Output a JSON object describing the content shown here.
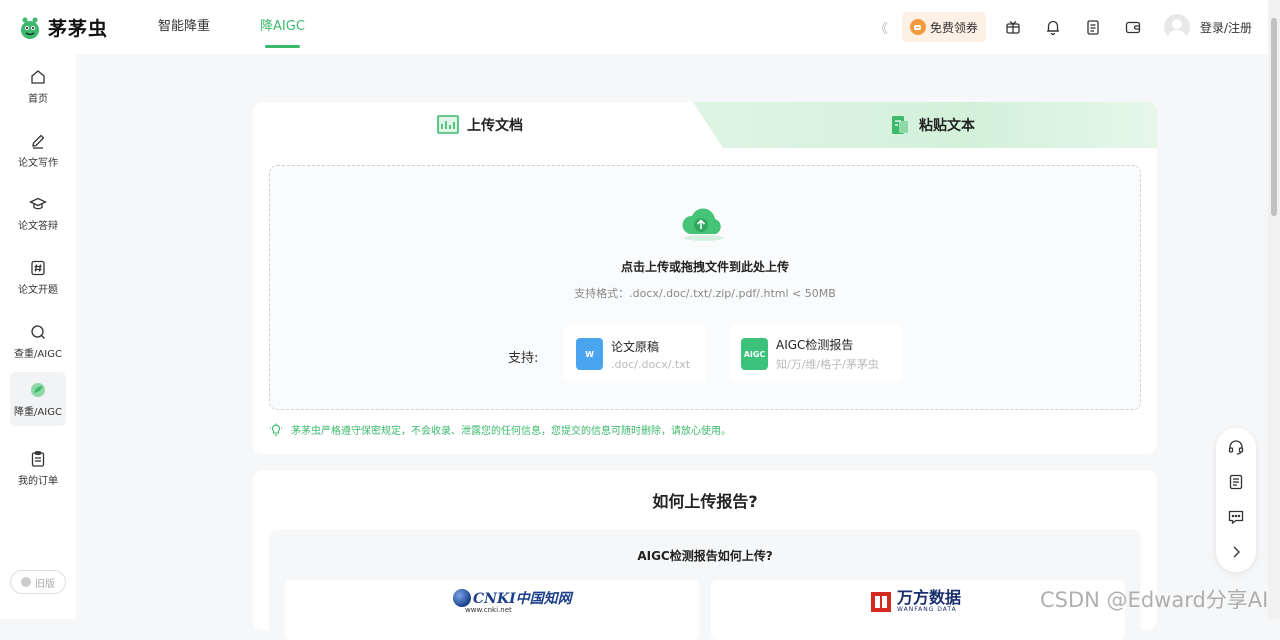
{
  "brand": {
    "name": "茅茅虫"
  },
  "nav": {
    "items": [
      {
        "label": "智能降重"
      },
      {
        "label": "降AIGC"
      }
    ]
  },
  "header": {
    "collapse_glyph": "《",
    "coupon_label": "免费领券",
    "login_label": "登录/注册"
  },
  "sidebar": {
    "items": [
      {
        "label": "首页",
        "icon": "home-icon"
      },
      {
        "label": "论文写作",
        "icon": "pen-icon"
      },
      {
        "label": "论文答辩",
        "icon": "graduation-cap-icon"
      },
      {
        "label": "论文开题",
        "icon": "hashtag-icon"
      },
      {
        "label": "查重/AIGC",
        "icon": "search-icon"
      },
      {
        "label": "降重/AIGC",
        "icon": "leaf-icon"
      },
      {
        "label": "我的订单",
        "icon": "clipboard-icon"
      }
    ],
    "old_version_label": "旧版"
  },
  "upload": {
    "tabs": [
      {
        "label": "上传文档"
      },
      {
        "label": "粘贴文本"
      }
    ],
    "drop_title": "点击上传或拖拽文件到此处上传",
    "drop_formats": "支持格式：.docx/.doc/.txt/.zip/.pdf/.html < 50MB",
    "support_label": "支持:",
    "formats": [
      {
        "name": "论文原稿",
        "desc": ".doc/.docx/.txt",
        "icon_text": "W",
        "color": "#4aa5ee"
      },
      {
        "name": "AIGC检测报告",
        "desc": "知/万/维/格子/茅茅虫",
        "icon_text": "AIGC",
        "color": "#3cc27a"
      }
    ],
    "privacy_note": "茅茅虫严格遵守保密规定，不会收录、泄露您的任何信息，您提交的信息可随时删除，请放心使用。"
  },
  "howto": {
    "title": "如何上传报告?",
    "subtitle": "AIGC检测报告如何上传?",
    "sources": [
      {
        "logo_text": "CNKI中国知网",
        "sub": "www.cnki.net"
      },
      {
        "logo_text": "万方数据",
        "sub": "WANFANG DATA"
      }
    ]
  },
  "watermark": "CSDN @Edward分享AI",
  "colors": {
    "accent": "#3cb96c",
    "coupon_bg": "#fdf0e4",
    "coupon_icon": "#f29a3c"
  }
}
